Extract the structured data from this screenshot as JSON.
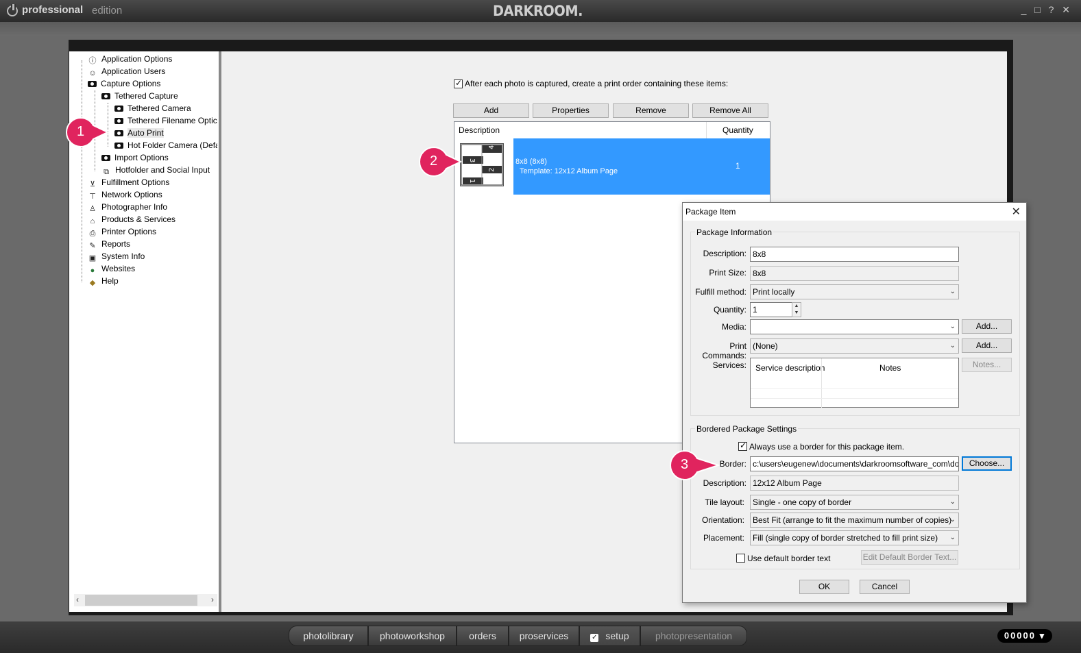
{
  "titlebar": {
    "brand_bold": "professional",
    "brand_light": "edition",
    "logo": "DARKROOM.",
    "window_controls": "_ □ ? ✕"
  },
  "tree": {
    "items": [
      {
        "label": "Application Options",
        "icon": "info-icon"
      },
      {
        "label": "Application Users",
        "icon": "users-icon"
      },
      {
        "label": "Capture Options",
        "icon": "camera-icon"
      },
      {
        "label": "Tethered Capture",
        "icon": "camera-icon"
      },
      {
        "label": "Tethered Camera",
        "icon": "camera-icon"
      },
      {
        "label": "Tethered Filename Optic",
        "icon": "camera-icon"
      },
      {
        "label": "Auto Print",
        "icon": "camera-icon"
      },
      {
        "label": "Hot Folder Camera (Defa",
        "icon": "camera-icon"
      },
      {
        "label": "Import Options",
        "icon": "camera-icon"
      },
      {
        "label": "Hotfolder and Social Input",
        "icon": "network-icon"
      },
      {
        "label": "Fulfillment Options",
        "icon": "cart-icon"
      },
      {
        "label": "Network Options",
        "icon": "antenna-icon"
      },
      {
        "label": "Photographer Info",
        "icon": "person-icon"
      },
      {
        "label": "Products & Services",
        "icon": "building-icon"
      },
      {
        "label": "Printer Options",
        "icon": "printer-icon"
      },
      {
        "label": "Reports",
        "icon": "pen-icon"
      },
      {
        "label": "System Info",
        "icon": "computer-icon"
      },
      {
        "label": "Websites",
        "icon": "globe-icon"
      },
      {
        "label": "Help",
        "icon": "book-icon"
      }
    ]
  },
  "autoprint": {
    "checkbox_label": "After each photo is captured, create a print order containing these items:",
    "checked": true,
    "buttons": {
      "add": "Add",
      "properties": "Properties",
      "remove": "Remove",
      "remove_all": "Remove All"
    },
    "columns": {
      "description": "Description",
      "quantity": "Quantity"
    },
    "rows": [
      {
        "line1": "8x8   (8x8)",
        "line2": "Template: 12x12 Album Page",
        "quantity": "1"
      }
    ]
  },
  "callouts": {
    "c1": "1",
    "c2": "2",
    "c3": "3"
  },
  "dialog": {
    "title": "Package Item",
    "package_info_label": "Package Information",
    "description_label": "Description:",
    "description_value": "8x8",
    "print_size_label": "Print Size:",
    "print_size_value": "8x8",
    "fulfill_label": "Fulfill method:",
    "fulfill_value": "Print locally",
    "quantity_label": "Quantity:",
    "quantity_value": "1",
    "media_label": "Media:",
    "media_value": "",
    "media_add": "Add...",
    "print_commands_label": "Print Commands:",
    "print_commands_value": "(None)",
    "print_commands_add": "Add...",
    "services_label": "Services:",
    "services_col1": "Service description",
    "services_col2": "Notes",
    "notes_button": "Notes...",
    "bordered_label": "Bordered Package Settings",
    "always_border_label": "Always use a border for this package item.",
    "always_border_checked": true,
    "border_label": "Border:",
    "border_value": "c:\\users\\eugenew\\documents\\darkroomsoftware_com\\downlo",
    "choose_button": "Choose...",
    "border_desc_label": "Description:",
    "border_desc_value": "12x12 Album Page",
    "tile_label": "Tile layout:",
    "tile_value": "Single - one copy of border",
    "orientation_label": "Orientation:",
    "orientation_value": "Best Fit (arrange to fit the maximum number of copies)",
    "placement_label": "Placement:",
    "placement_value": "Fill (single copy of border stretched to fill print size)",
    "default_text_label": "Use default border text",
    "default_text_checked": false,
    "edit_default_button": "Edit Default Border Text...",
    "ok": "OK",
    "cancel": "Cancel"
  },
  "nav": {
    "tabs": [
      "photolibrary",
      "photoworkshop",
      "orders",
      "proservices",
      "setup",
      "photopresentation"
    ],
    "active": "setup",
    "counter": "00000 ▾"
  },
  "colors": {
    "selection": "#3399ff",
    "callout": "#e0245e"
  }
}
